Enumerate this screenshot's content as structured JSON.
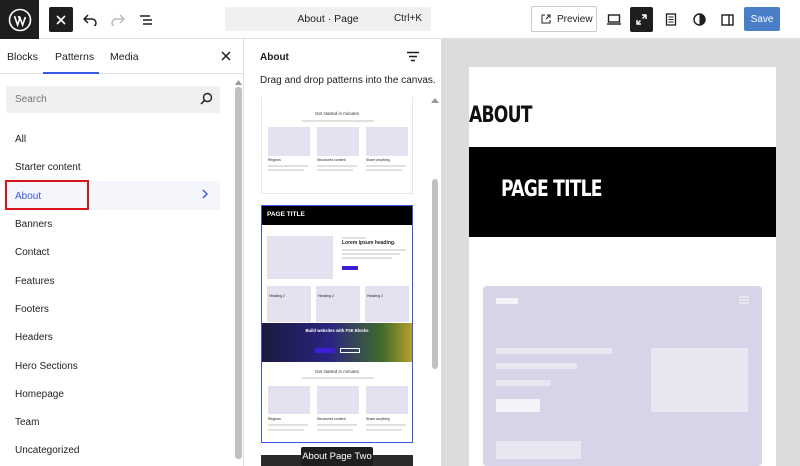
{
  "topbar": {
    "command_title": "About · Page",
    "command_shortcut": "Ctrl+K",
    "preview_label": "Preview",
    "save_label": "Save"
  },
  "sidebar": {
    "tabs": [
      "Blocks",
      "Patterns",
      "Media"
    ],
    "active_tab": "Patterns",
    "search_placeholder": "Search",
    "categories": [
      "All",
      "Starter content",
      "About",
      "Banners",
      "Contact",
      "Features",
      "Footers",
      "Headers",
      "Hero Sections",
      "Homepage",
      "Team",
      "Uncategorized"
    ],
    "active_category": "About"
  },
  "patterns_panel": {
    "title": "About",
    "hint": "Drag and drop patterns into the canvas.",
    "tooltip": "About Page Two",
    "card1": {
      "heading": "Get started in minutes",
      "columns": [
        "Regions",
        "Structured content",
        "Share anything"
      ]
    },
    "card2": {
      "banner_title": "PAGE TITLE",
      "lorem_heading": "Lorem ipsum heading.",
      "features": [
        "Heading 2",
        "Heading 2",
        "Heading 2"
      ],
      "cta_title": "Build websites with FSE Blocks",
      "bottom_heading": "Get started in minutes",
      "columns": [
        "Regions",
        "Structured content",
        "Share anything"
      ]
    }
  },
  "canvas": {
    "about_heading": "ABOUT",
    "page_title": "PAGE TITLE"
  },
  "colors": {
    "accent": "#3858e9",
    "highlight_border": "#d8141a",
    "dark": "#1e1e1e",
    "lavender": "#d7d4e7"
  }
}
